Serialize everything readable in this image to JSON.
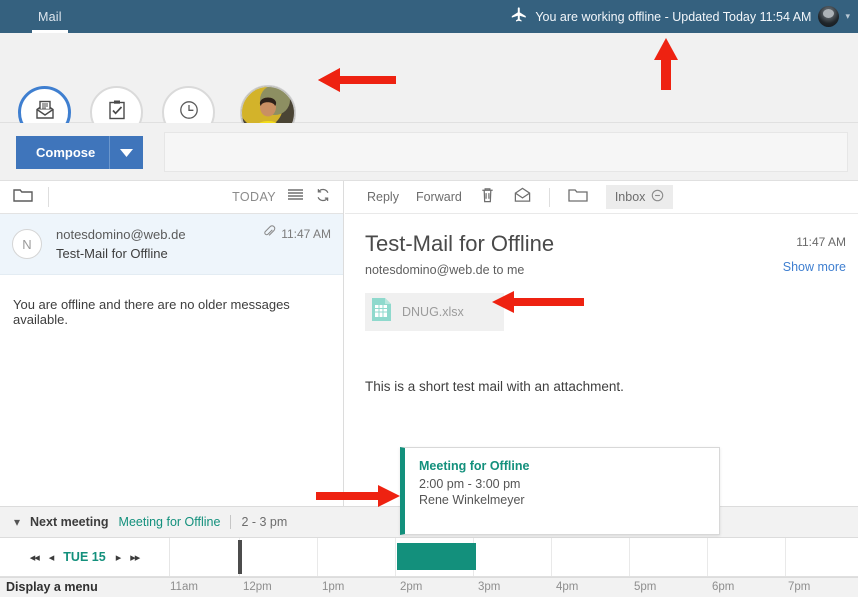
{
  "topbar": {
    "tab_label": "Mail",
    "plane_icon": "airplane-icon",
    "offline_status": "You are working offline - Updated Today 11:54 AM",
    "avatar_icon": "user-avatar",
    "caret_icon": "chevron-down-icon",
    "bg_color": "#35617f"
  },
  "nav": {
    "items": [
      {
        "name": "mail",
        "icon": "mail-open-icon",
        "active": true
      },
      {
        "name": "tasks",
        "icon": "clipboard-check-icon",
        "active": false
      },
      {
        "name": "recent",
        "icon": "clock-icon",
        "active": false
      }
    ],
    "profile_photo": "user-photo-avatar",
    "active_color": "#3f7fd0"
  },
  "compose": {
    "label": "Compose",
    "caret_icon": "caret-down-icon",
    "button_color": "#3f75bb",
    "search_value": ""
  },
  "list": {
    "folder_icon": "folder-icon",
    "sort_label": "TODAY",
    "list_icon": "list-lines-icon",
    "refresh_icon": "refresh-icon",
    "messages": [
      {
        "initial": "N",
        "from": "notesdomino@web.de",
        "subject": "Test-Mail for Offline",
        "time": "11:47 AM",
        "attachment_icon": "paperclip-icon",
        "selected": true
      }
    ],
    "empty_note": "You are offline and there are no older messages available."
  },
  "read": {
    "toolbar": {
      "reply": "Reply",
      "forward": "Forward",
      "delete_icon": "trash-icon",
      "mark_icon": "envelope-icon",
      "move_icon": "folder-icon",
      "folder_chip": "Inbox",
      "folder_chip_remove_icon": "minus-circle-icon"
    },
    "subject": "Test-Mail for Offline",
    "sender": "notesdomino@web.de to me",
    "time": "11:47 AM",
    "show_more": "Show more",
    "attachment": {
      "name": "DNUG.xlsx",
      "icon": "spreadsheet-file-icon"
    },
    "body": "This is a short test mail with an attachment."
  },
  "meeting_card": {
    "title": "Meeting for Offline",
    "time": "2:00 pm - 3:00 pm",
    "organizer": "Rene Winkelmeyer",
    "accent_color": "#13907c"
  },
  "next_meeting": {
    "caret_icon": "chevron-down-icon",
    "label": "Next meeting",
    "title": "Meeting for Offline",
    "time": "2 - 3 pm"
  },
  "calendar": {
    "first_icon": "skip-to-start-icon",
    "prev_icon": "prev-icon",
    "date_label": "TUE 15",
    "next_icon": "next-icon",
    "last_icon": "skip-to-end-icon",
    "hours": [
      "11am",
      "12pm",
      "1pm",
      "2pm",
      "3pm",
      "4pm",
      "5pm",
      "6pm",
      "7pm"
    ],
    "event": {
      "start": "2pm",
      "end": "3pm",
      "color": "#13907c"
    },
    "current_time_marker": true
  },
  "statusbar": {
    "text": "Display a menu"
  }
}
